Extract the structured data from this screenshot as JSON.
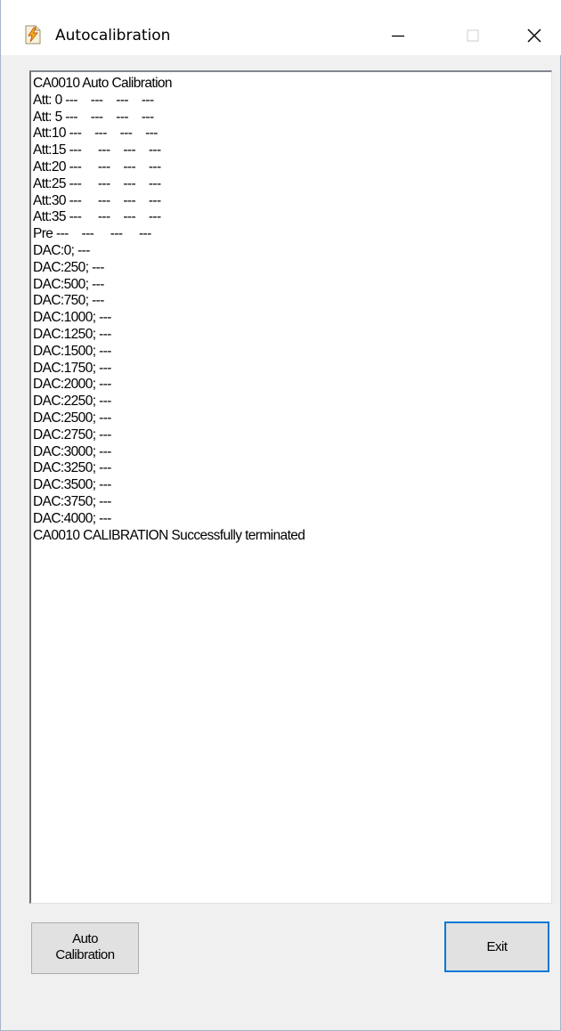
{
  "window": {
    "title": "Autocalibration",
    "controls": {
      "minimize": "minimize",
      "maximize": "maximize",
      "close": "close"
    }
  },
  "log": {
    "lines": [
      "CA0010 Auto Calibration",
      "Att: 0 ---    ---    ---    ---",
      "Att: 5 ---    ---    ---    ---",
      "Att:10 ---    ---    ---    ---",
      "Att:15 ---     ---    ---    ---",
      "Att:20 ---     ---    ---    ---",
      "Att:25 ---     ---    ---    ---",
      "Att:30 ---     ---    ---    ---",
      "Att:35 ---     ---    ---    ---",
      "Pre ---    ---     ---     ---",
      "DAC:0; ---",
      "DAC:250; ---",
      "DAC:500; ---",
      "DAC:750; ---",
      "DAC:1000; ---",
      "DAC:1250; ---",
      "DAC:1500; ---",
      "DAC:1750; ---",
      "DAC:2000; ---",
      "DAC:2250; ---",
      "DAC:2500; ---",
      "DAC:2750; ---",
      "DAC:3000; ---",
      "DAC:3250; ---",
      "DAC:3500; ---",
      "DAC:3750; ---",
      "DAC:4000; ---",
      "CA0010 CALIBRATION Successfully terminated"
    ]
  },
  "buttons": {
    "auto_calibration_line1": "Auto",
    "auto_calibration_line2": "Calibration",
    "exit": "Exit"
  }
}
